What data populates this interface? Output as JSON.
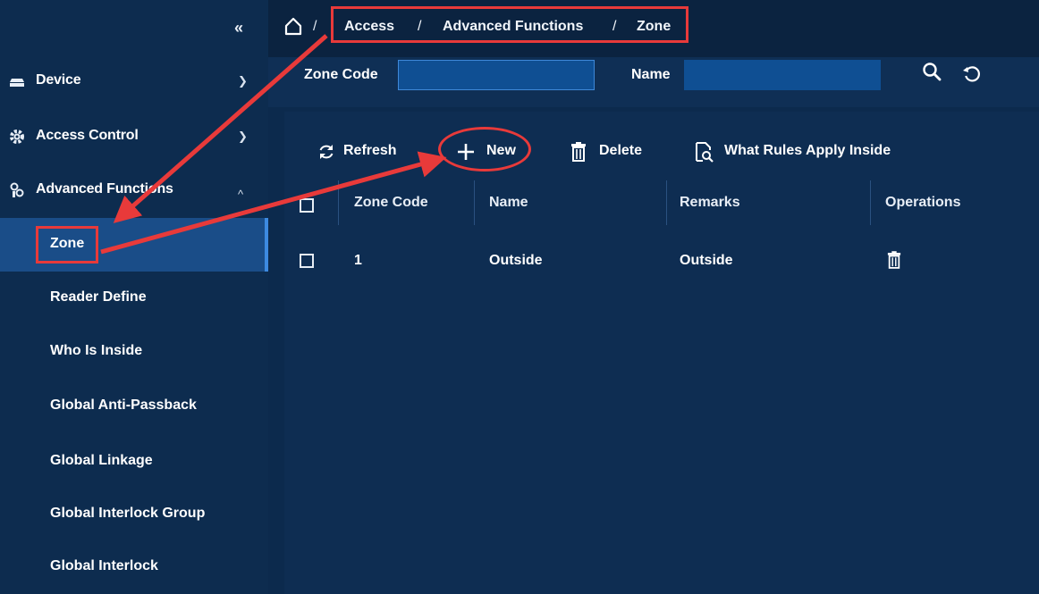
{
  "sidebar": {
    "collapse_glyph": "«",
    "items": [
      {
        "label": "Device",
        "icon": "device-icon"
      },
      {
        "label": "Access Control",
        "icon": "gear-icon"
      },
      {
        "label": "Advanced Functions",
        "icon": "advanced-functions-icon"
      }
    ],
    "sub_items": [
      {
        "label": "Zone",
        "active": true
      },
      {
        "label": "Reader Define"
      },
      {
        "label": "Who Is Inside"
      },
      {
        "label": "Global Anti-Passback"
      },
      {
        "label": "Global Linkage"
      },
      {
        "label": "Global Interlock Group"
      },
      {
        "label": "Global Interlock"
      }
    ]
  },
  "breadcrumb": {
    "separator": "/",
    "items": [
      "Access",
      "Advanced Functions",
      "Zone"
    ]
  },
  "filters": {
    "zone_code_label": "Zone Code",
    "zone_code_value": "",
    "name_label": "Name",
    "name_value": ""
  },
  "toolbar": {
    "refresh_label": "Refresh",
    "new_label": "New",
    "delete_label": "Delete",
    "rules_label": "What Rules Apply Inside"
  },
  "table": {
    "columns": [
      "Zone Code",
      "Name",
      "Remarks",
      "Operations"
    ],
    "rows": [
      {
        "zone_code": "1",
        "name": "Outside",
        "remarks": "Outside",
        "operation_icon": "trash-icon"
      }
    ]
  },
  "colors": {
    "background": "#0c2a4d",
    "sidebar_active": "#1a4d88",
    "annotation_red": "#e83a3a",
    "input_blue": "#0f4f93"
  }
}
